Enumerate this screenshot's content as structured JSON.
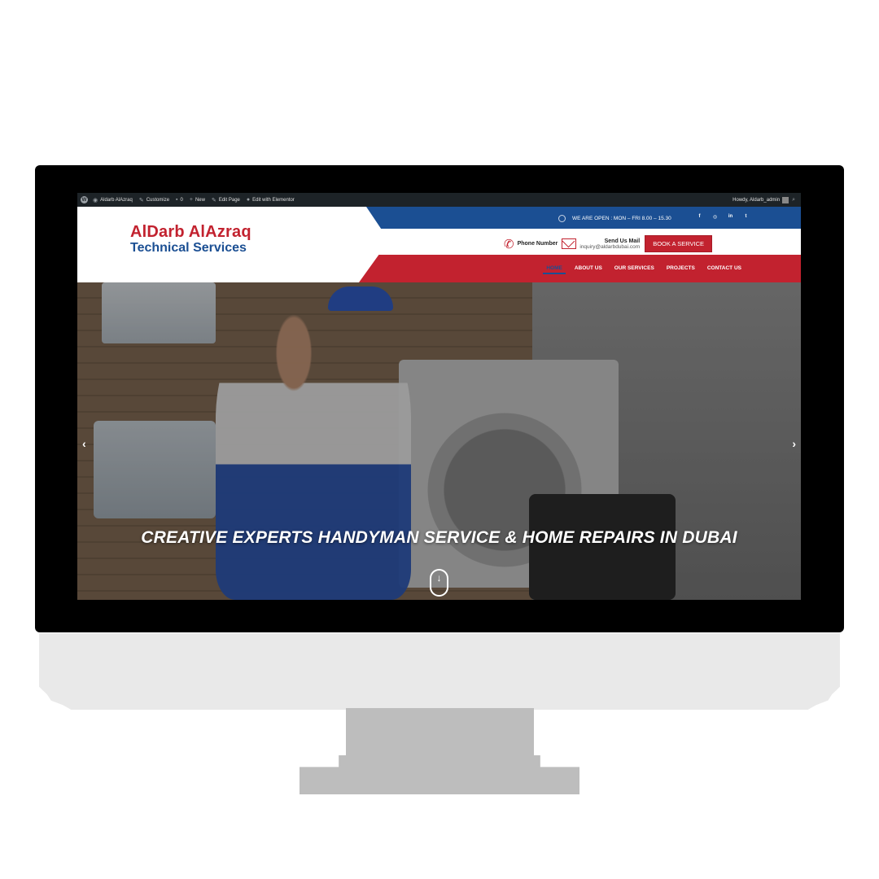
{
  "adminbar": {
    "items": [
      {
        "icon": "wordpress-icon",
        "label": ""
      },
      {
        "icon": "dashboard-icon",
        "label": "Aldarb AlAzraq"
      },
      {
        "icon": "brush-icon",
        "label": "Customize"
      },
      {
        "icon": "comment-icon",
        "label": "0"
      },
      {
        "icon": "plus-icon",
        "label": "New"
      },
      {
        "icon": "pencil-icon",
        "label": "Edit Page"
      },
      {
        "icon": "elementor-icon",
        "label": "Edit with Elementor"
      }
    ],
    "howdy": "Howdy, Aldarb_admin"
  },
  "header": {
    "logo_line1": "AlDarb AlAzraq",
    "logo_line2": "Technical Services",
    "hours": "WE ARE OPEN : MON – FRI 8.00 – 15.30",
    "socials": [
      "facebook-icon",
      "instagram-icon",
      "linkedin-icon",
      "twitter-icon"
    ],
    "phone_label": "Phone Number",
    "mail_label": "Send Us Mail",
    "mail_value": "inquiry@aldarbdubai.com",
    "book_button": "BOOK A SERVICE"
  },
  "nav": {
    "items": [
      "HOME",
      "ABOUT US",
      "OUR SERVICES",
      "PROJECTS",
      "CONTACT US"
    ],
    "active_index": 0
  },
  "hero": {
    "title": "CREATIVE EXPERTS HANDYMAN SERVICE & HOME REPAIRS IN DUBAI",
    "prev_arrow": "‹",
    "next_arrow": "›",
    "scroll_arrow": "↓"
  },
  "colors": {
    "brand_red": "#c2222f",
    "brand_blue": "#1b4f93",
    "adminbar": "#1d2327"
  }
}
